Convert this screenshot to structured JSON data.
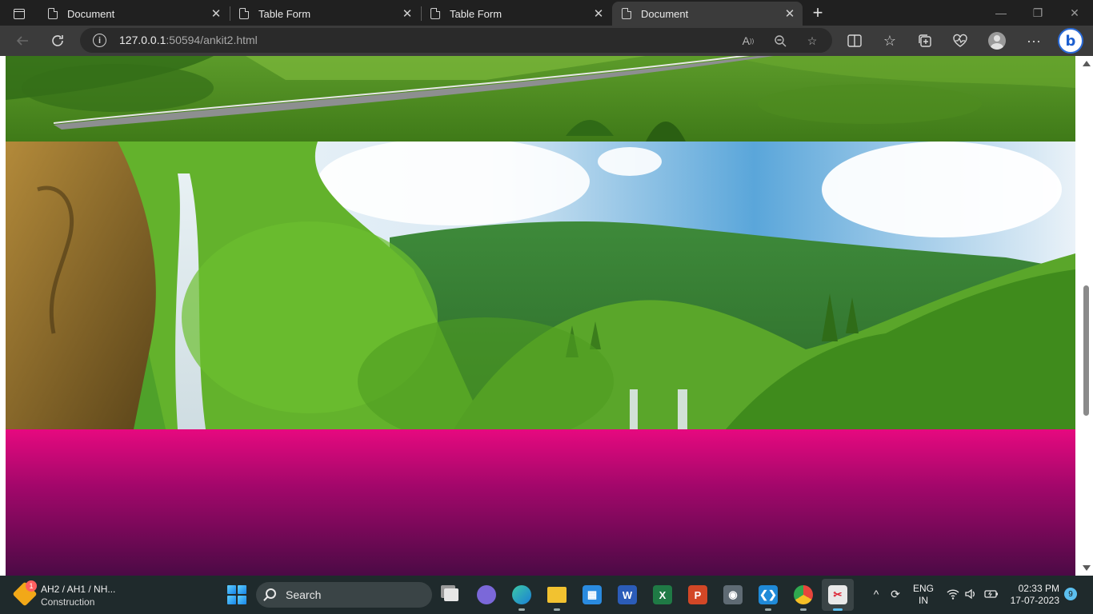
{
  "tabs": [
    {
      "title": "Document",
      "active": false
    },
    {
      "title": "Table Form",
      "active": false
    },
    {
      "title": "Table Form",
      "active": false
    },
    {
      "title": "Document",
      "active": true
    }
  ],
  "address": {
    "host": "127.0.0.1",
    "port_path": ":50594/ankit2.html"
  },
  "taskbar": {
    "notification": {
      "badge": "1",
      "line1": "AH2 / AH1 / NH...",
      "line2": "Construction"
    },
    "search_label": "Search",
    "language": {
      "line1": "ENG",
      "line2": "IN"
    },
    "clock": {
      "time": "02:33 PM",
      "date": "17-07-2023"
    },
    "notification_count": "9"
  },
  "page": {
    "images": [
      "green-road-landscape",
      "waterfall-forest-landscape"
    ],
    "gradient_colors": [
      "#e6097f",
      "#a1076a",
      "#4b0a45"
    ]
  }
}
